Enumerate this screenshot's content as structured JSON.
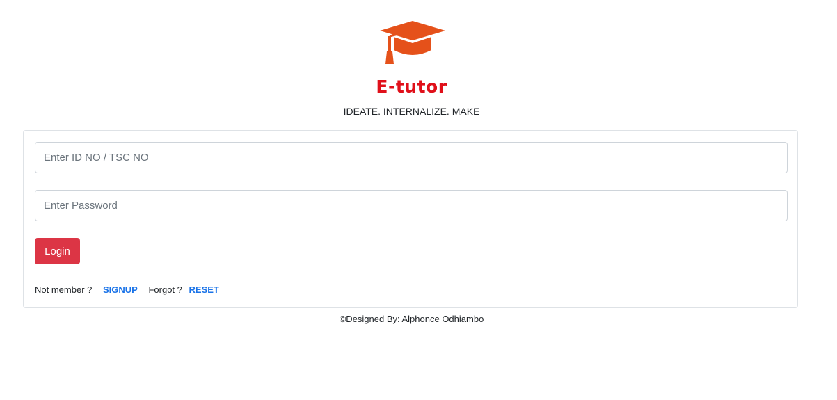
{
  "header": {
    "logo_icon": "graduation-cap-icon",
    "logo_color": "#e5511a",
    "brand_name": "E-tutor",
    "brand_color": "#e0101a",
    "tagline": "IDEATE. INTERNALIZE. MAKE"
  },
  "login_form": {
    "id_field": {
      "placeholder": "Enter ID NO / TSC NO",
      "value": ""
    },
    "password_field": {
      "placeholder": "Enter Password",
      "value": ""
    },
    "login_label": "Login",
    "login_color": "#dc3545",
    "not_member_text": "Not member ?",
    "signup_label": "SIGNUP",
    "forgot_text": "Forgot ?",
    "reset_label": "RESET",
    "link_color": "#1a73e8"
  },
  "footer": {
    "credit": "©Designed By: Alphonce Odhiambo"
  }
}
